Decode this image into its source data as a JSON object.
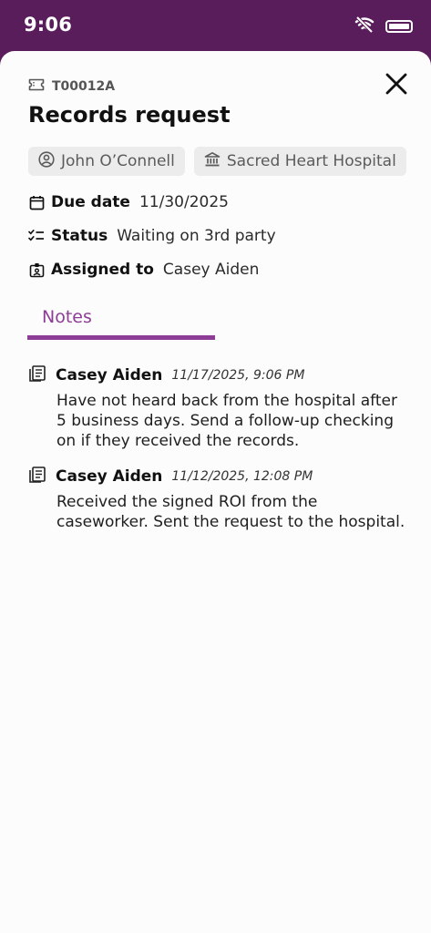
{
  "status_bar": {
    "time": "9:06"
  },
  "ticket": {
    "id": "T00012A",
    "title": "Records request",
    "chips": [
      {
        "icon": "person-circle-icon",
        "label": "John O’Connell"
      },
      {
        "icon": "hospital-building-icon",
        "label": "Sacred Heart Hospital"
      }
    ],
    "due_date": {
      "label": "Due date",
      "value": "11/30/2025"
    },
    "status": {
      "label": "Status",
      "value": "Waiting on 3rd party"
    },
    "assigned": {
      "label": "Assigned to",
      "value": "Casey Aiden"
    }
  },
  "tabs": [
    {
      "label": "Notes",
      "active": true
    }
  ],
  "notes": [
    {
      "author": "Casey Aiden",
      "date": "11/17/2025, 9:06 PM",
      "body": "Have not heard back from the hospital after 5 business days. Send a follow-up checking on if they received the records."
    },
    {
      "author": "Casey Aiden",
      "date": "11/12/2025, 12:08 PM",
      "body": "Received the signed ROI from the caseworker. Sent the request to the hospital."
    }
  ],
  "colors": {
    "header": "#5a1d5c",
    "accent": "#8d3d96",
    "chip_bg": "#ececec"
  }
}
